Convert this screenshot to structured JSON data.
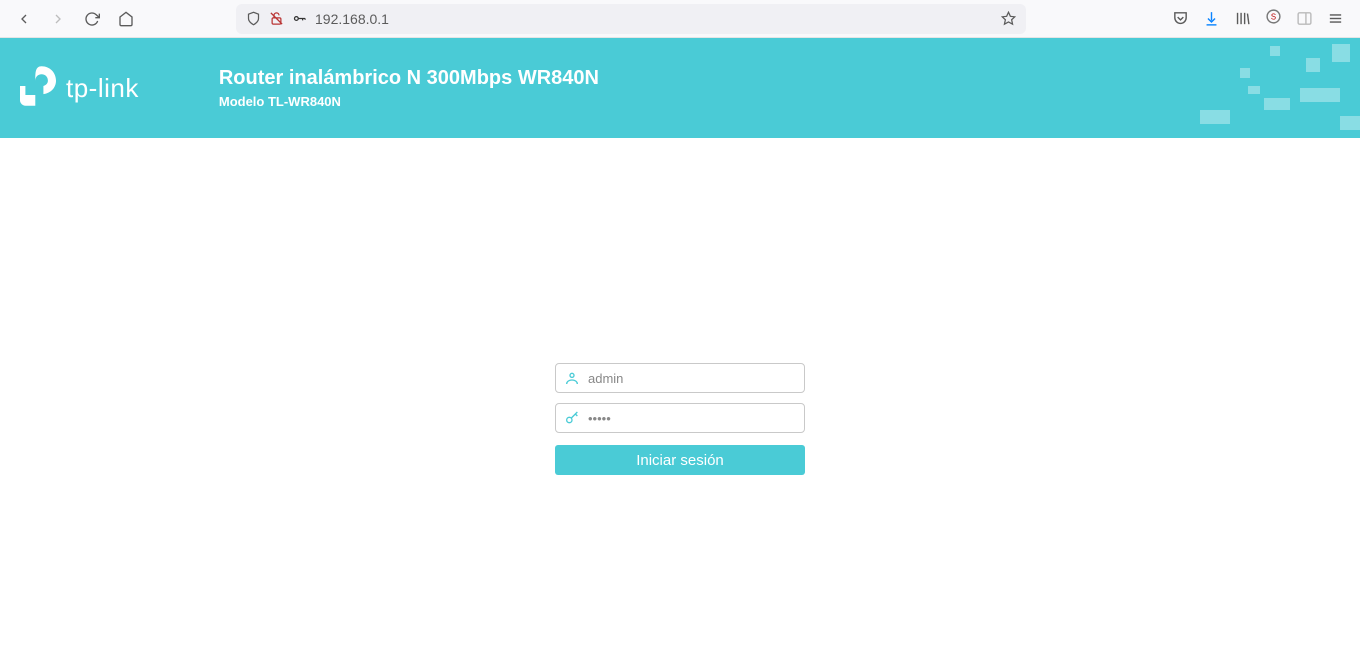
{
  "browser": {
    "url": "192.168.0.1"
  },
  "banner": {
    "brand": "tp-link",
    "title": "Router inalámbrico N 300Mbps WR840N",
    "subtitle": "Modelo TL-WR840N"
  },
  "login": {
    "username_value": "admin",
    "password_value": "•••••",
    "button_label": "Iniciar sesión"
  }
}
